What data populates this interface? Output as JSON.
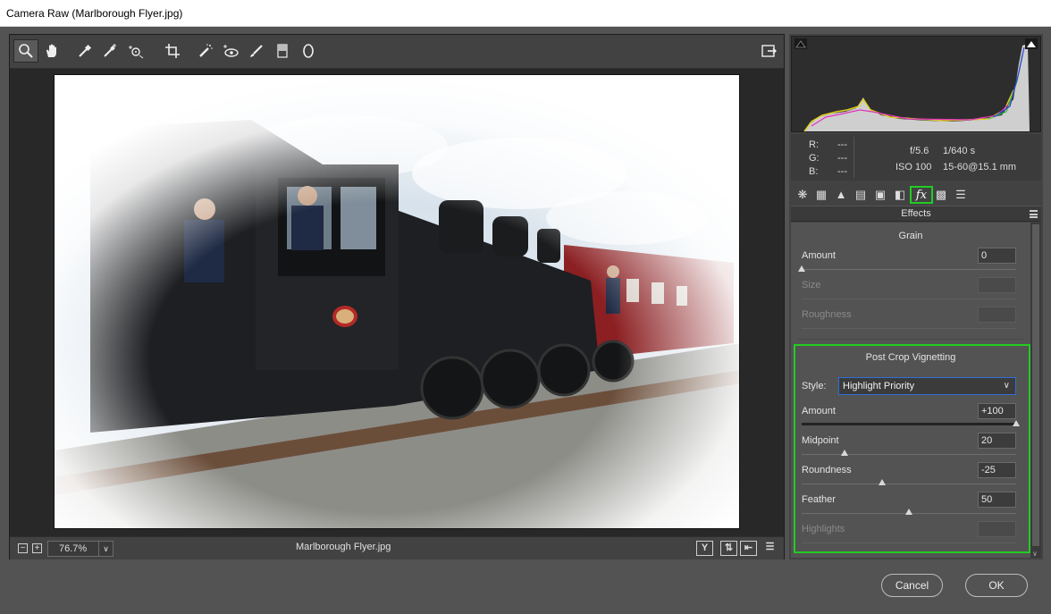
{
  "window": {
    "title": "Camera Raw (Marlborough Flyer.jpg)"
  },
  "toolbar": {
    "tools": [
      "zoom-tool-icon",
      "hand-tool-icon",
      "white-balance-icon",
      "color-sampler-icon",
      "targeted-adjustment-icon",
      "crop-icon",
      "spot-removal-icon",
      "red-eye-icon",
      "adjustment-brush-icon",
      "graduated-filter-icon",
      "radial-filter-icon"
    ],
    "open_prefs_icon": "open-preferences-icon"
  },
  "status": {
    "zoom": "76.7%",
    "filename": "Marlborough Flyer.jpg",
    "zoom_out": "−",
    "zoom_in": "+",
    "before_after_label": "Y"
  },
  "histogram": {
    "r_label": "R:",
    "g_label": "G:",
    "b_label": "B:",
    "r_value": "---",
    "g_value": "---",
    "b_value": "---",
    "aperture": "f/5.6",
    "shutter": "1/640 s",
    "iso": "ISO 100",
    "lens": "15-60@15.1 mm"
  },
  "panel": {
    "title": "Effects",
    "grain": {
      "title": "Grain",
      "amount_label": "Amount",
      "amount_value": "0",
      "size_label": "Size",
      "roughness_label": "Roughness"
    },
    "vignetting": {
      "title": "Post Crop Vignetting",
      "style_label": "Style:",
      "style_value": "Highlight Priority",
      "amount_label": "Amount",
      "amount_value": "+100",
      "midpoint_label": "Midpoint",
      "midpoint_value": "20",
      "roundness_label": "Roundness",
      "roundness_value": "-25",
      "feather_label": "Feather",
      "feather_value": "50",
      "highlights_label": "Highlights"
    }
  },
  "buttons": {
    "cancel": "Cancel",
    "ok": "OK"
  },
  "colors": {
    "highlight_box": "#22cc22",
    "select_border": "#2f6fd6"
  }
}
